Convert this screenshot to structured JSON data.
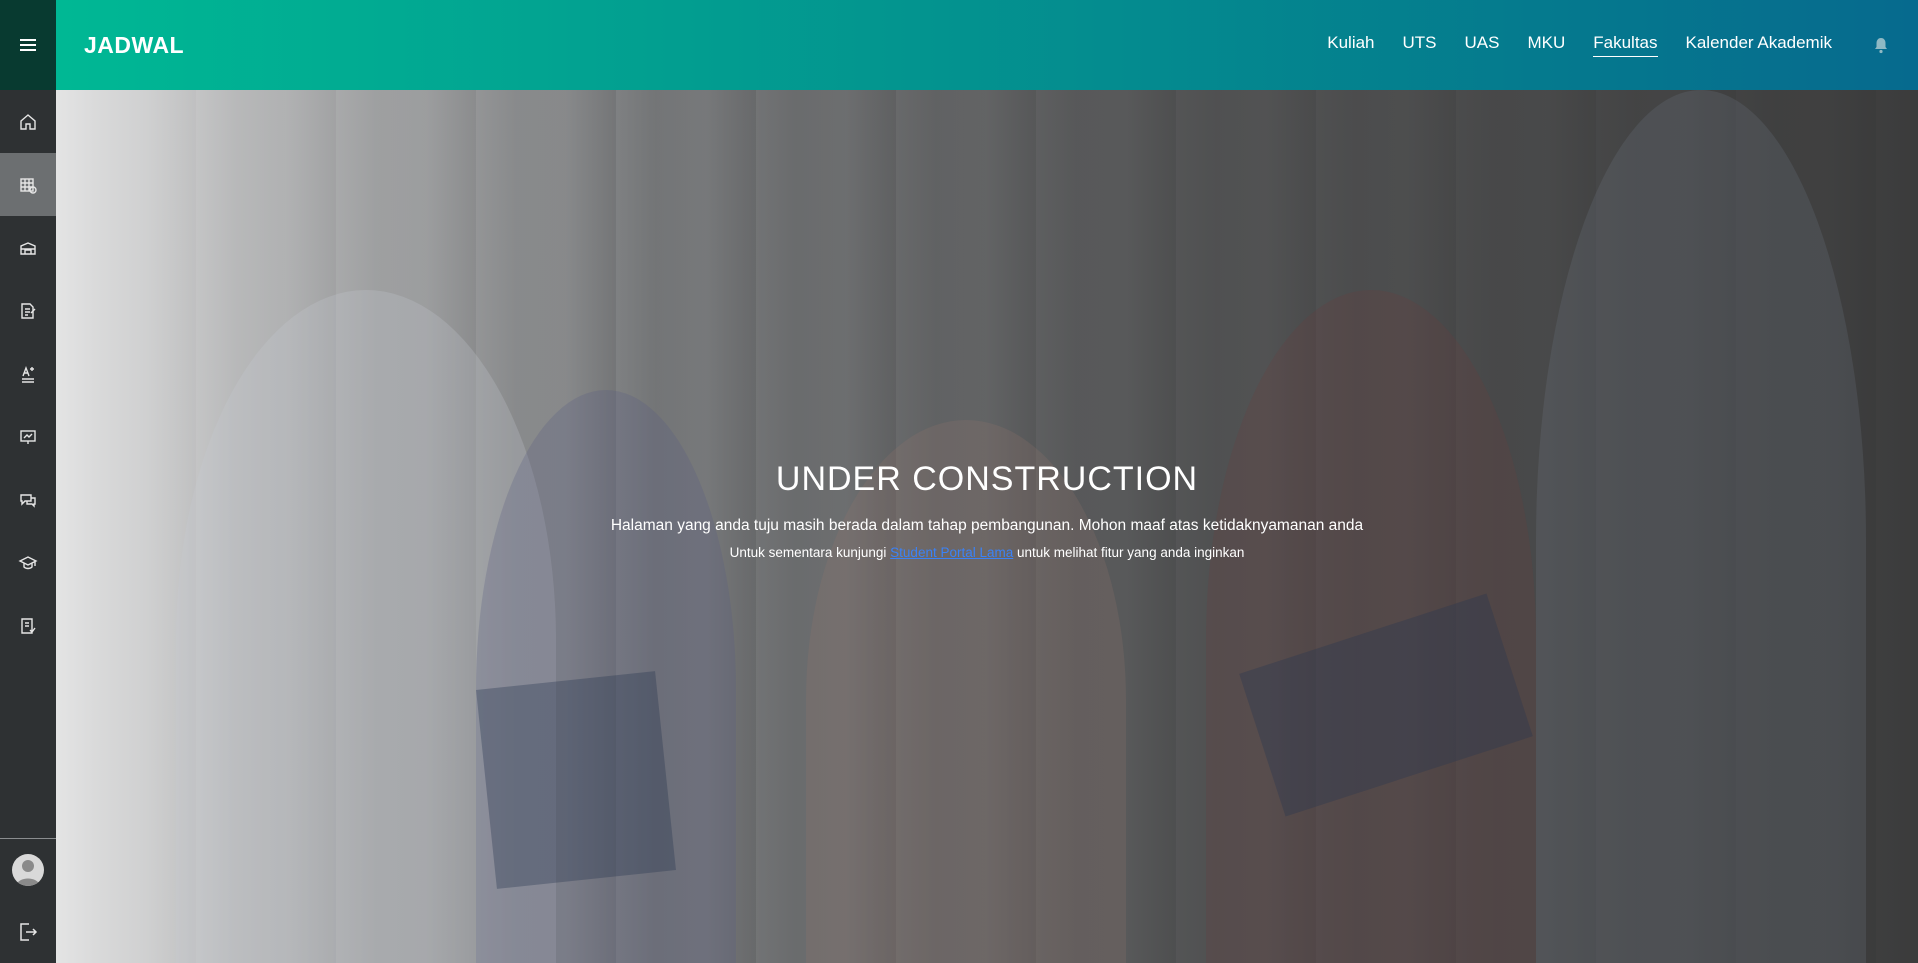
{
  "brand": "JADWAL",
  "topnav": [
    {
      "label": "Kuliah"
    },
    {
      "label": "UTS"
    },
    {
      "label": "UAS"
    },
    {
      "label": "MKU"
    },
    {
      "label": "Fakultas",
      "active": true
    },
    {
      "label": "Kalender Akademik"
    }
  ],
  "sidebar": {
    "menu_icon": "hamburger-icon",
    "items": [
      {
        "icon": "home-icon"
      },
      {
        "icon": "schedule-icon",
        "active": true
      },
      {
        "icon": "building-icon"
      },
      {
        "icon": "document-edit-icon"
      },
      {
        "icon": "grades-icon"
      },
      {
        "icon": "presentation-icon"
      },
      {
        "icon": "chat-icon"
      },
      {
        "icon": "graduation-cap-icon"
      },
      {
        "icon": "checklist-icon"
      }
    ],
    "avatar_icon": "user-avatar-icon",
    "logout_icon": "logout-icon"
  },
  "notification_icon": "bell-icon",
  "message": {
    "title": "UNDER CONSTRUCTION",
    "line1": "Halaman yang anda tuju masih berada dalam tahap pembangunan. Mohon maaf atas ketidaknyamanan anda",
    "line2_prefix": "Untuk sementara kunjungi ",
    "line2_link": "Student Portal Lama",
    "line2_suffix": " untuk melihat fitur yang anda inginkan"
  },
  "colors": {
    "topbar_gradient_start": "#00b894",
    "topbar_gradient_end": "#066a8e",
    "sidebar_bg": "#2e3133",
    "sidebar_active": "#6c6f71",
    "link": "#3b82f6"
  }
}
